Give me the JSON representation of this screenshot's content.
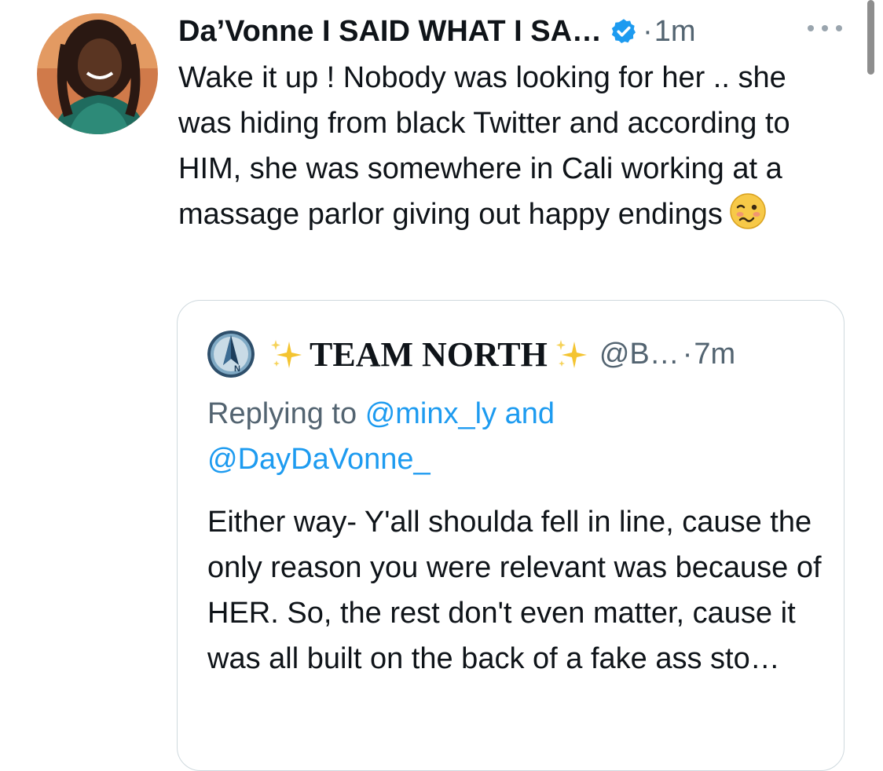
{
  "tweet": {
    "display_name": "Da’Vonne I SAID WHAT I SA…",
    "separator": "·",
    "time": "1m",
    "text": "Wake it up ! Nobody was looking for her .. she was hiding from black Twitter and according to HIM, she was somewhere in Cali working at a massage parlor giving out happy endings",
    "emoji": "woozy-face",
    "verified": true,
    "verified_color": "#1d9bf0"
  },
  "quoted": {
    "display_name": "TEAM NORTH",
    "name_emoji": "sparkles",
    "handle": "@B…",
    "separator": "·",
    "time": "7m",
    "replying_prefix": "Replying to",
    "mention_1": "@minx_ly",
    "and_word": "and",
    "mention_2": "@DayDaVonne_",
    "text": "Either way- Y'all shoulda fell in line, cause the only reason you were relevant was because of HER. So, the rest don't even matter, cause it was all built on the back of a fake ass sto…",
    "avatar_letter": "N"
  },
  "colors": {
    "text_primary": "#0f1419",
    "text_secondary": "#536471",
    "link": "#1d9bf0",
    "border": "#cfd9de"
  }
}
